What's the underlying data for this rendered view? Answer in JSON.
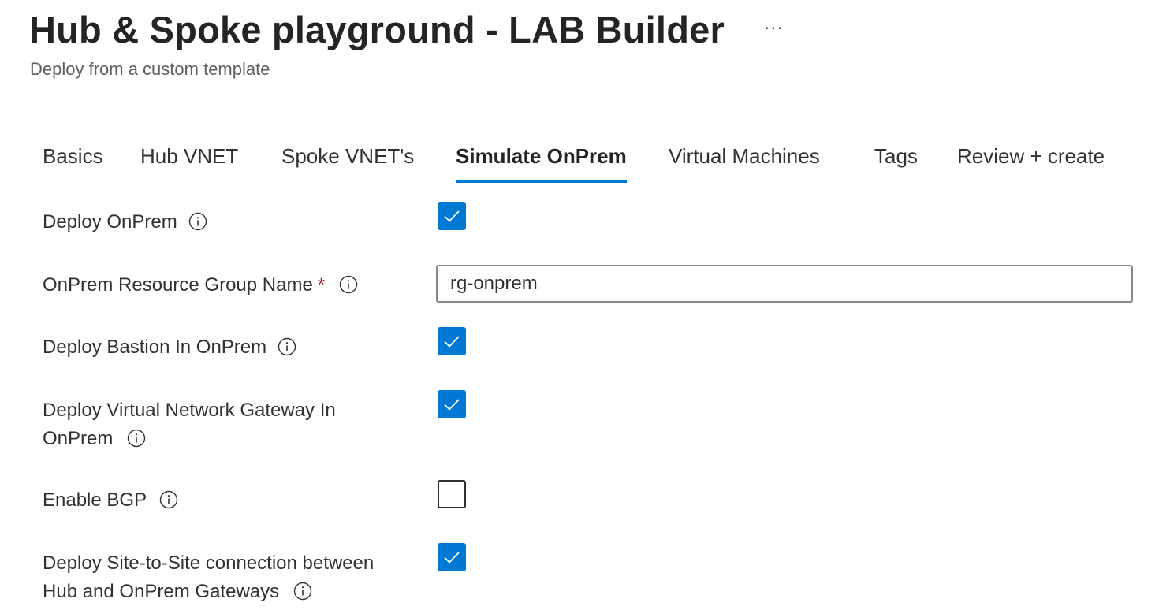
{
  "header": {
    "title": "Hub & Spoke playground - LAB Builder",
    "more_label": "···",
    "subtitle": "Deploy from a custom template"
  },
  "tabs": [
    {
      "label": "Basics",
      "active": false
    },
    {
      "label": "Hub VNET",
      "active": false
    },
    {
      "label": "Spoke VNET's",
      "active": false
    },
    {
      "label": "Simulate OnPrem",
      "active": true
    },
    {
      "label": "Virtual Machines",
      "active": false
    },
    {
      "label": "Tags",
      "active": false
    },
    {
      "label": "Review + create",
      "active": false
    }
  ],
  "form": {
    "deploy_onprem": {
      "label": "Deploy OnPrem",
      "checked": true
    },
    "rg_name": {
      "label": "OnPrem Resource Group Name",
      "required_mark": "*",
      "value": "rg-onprem"
    },
    "deploy_bastion": {
      "label": "Deploy Bastion In OnPrem",
      "checked": true
    },
    "deploy_vng": {
      "label_line1": "Deploy Virtual Network Gateway In",
      "label_line2": "OnPrem",
      "checked": true
    },
    "enable_bgp": {
      "label": "Enable BGP",
      "checked": false
    },
    "deploy_s2s": {
      "label_line1": "Deploy Site-to-Site connection between",
      "label_line2": "Hub and OnPrem Gateways",
      "checked": true
    }
  },
  "colors": {
    "accent": "#0078d4",
    "required": "#a4262c"
  },
  "icons": {
    "info": "info-icon",
    "check": "checkmark-icon",
    "more": "more-ellipsis-icon"
  }
}
